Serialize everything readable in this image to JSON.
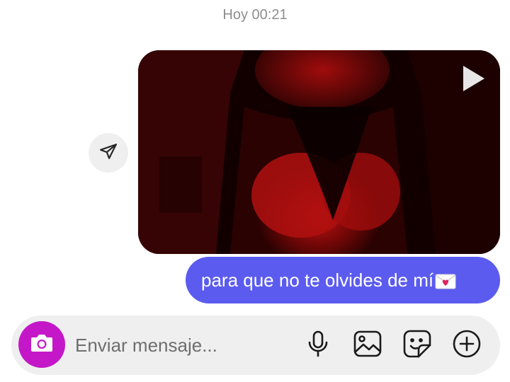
{
  "conversation": {
    "timestamp": "Hoy 00:21"
  },
  "messages": {
    "video": {
      "thumbnail_icon": "video-thumbnail",
      "play_icon": "play-icon"
    },
    "text": {
      "content": "para que no te olvides de mí",
      "emoji_icon": "love-letter-icon"
    },
    "share_icon": "send-arrow-icon"
  },
  "composer": {
    "placeholder": "Enviar mensaje...",
    "value": "",
    "camera_icon": "camera-icon",
    "mic_icon": "microphone-icon",
    "gallery_icon": "gallery-icon",
    "sticker_icon": "sticker-icon",
    "plus_icon": "plus-circle-icon"
  },
  "colors": {
    "sent_bubble": "#5b5bf0",
    "camera_button": "#c418c8",
    "composer_bg": "#efefef",
    "timestamp_text": "#8e8e8e"
  }
}
